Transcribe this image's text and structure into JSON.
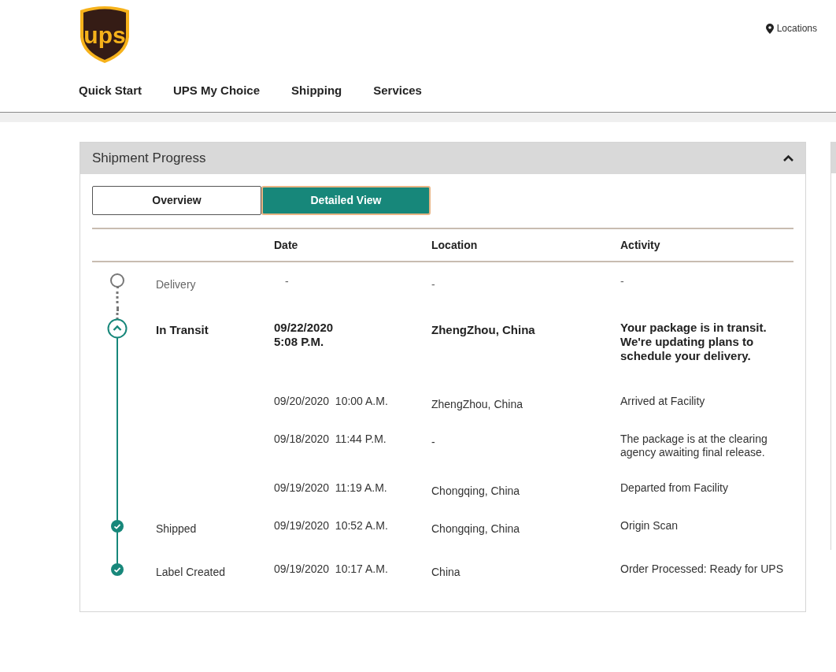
{
  "header": {
    "logo": {
      "text": "ups"
    },
    "locations_link": "Locations",
    "nav": [
      "Quick Start",
      "UPS My Choice",
      "Shipping",
      "Services"
    ]
  },
  "panel": {
    "title": "Shipment Progress",
    "expanded": true,
    "view_tabs": [
      {
        "label": "Overview",
        "selected": false
      },
      {
        "label": "Detailed View",
        "selected": true
      }
    ],
    "table": {
      "columns": [
        "Date",
        "Location",
        "Activity"
      ],
      "rows": [
        {
          "kind": "pending",
          "status": "Delivery",
          "date": "-",
          "location": "-",
          "activity": "-"
        },
        {
          "kind": "current",
          "status": "In Transit",
          "date": "09/22/2020\n5:08 P.M.",
          "location": "ZhengZhou, China",
          "activity": "Your package is in transit. We're updating plans to schedule your delivery."
        },
        {
          "kind": "event",
          "date": "09/20/2020  10:00 A.M.",
          "location": "ZhengZhou, China",
          "activity": "Arrived at Facility"
        },
        {
          "kind": "event",
          "date": "09/18/2020  11:44 P.M.",
          "location": "-",
          "activity": "The package is at the clearing agency awaiting final release."
        },
        {
          "kind": "event",
          "date": "09/19/2020  11:19 A.M.",
          "location": "Chongqing, China",
          "activity": "Departed from Facility"
        },
        {
          "kind": "done",
          "status": "Shipped",
          "date": "09/19/2020  10:52 A.M.",
          "location": "Chongqing, China",
          "activity": "Origin Scan"
        },
        {
          "kind": "done",
          "status": "Label Created",
          "date": "09/19/2020  10:17 A.M.",
          "location": "China",
          "activity": "Order Processed: Ready for UPS"
        }
      ]
    }
  }
}
